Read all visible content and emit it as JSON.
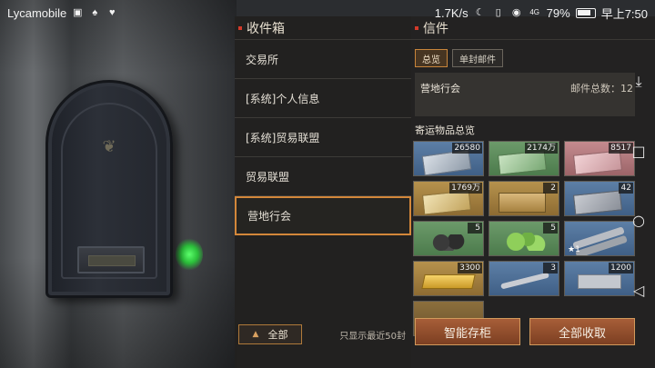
{
  "statusbar": {
    "carrier": "Lycamobile",
    "left_icons": [
      "photo-icon",
      "qq-icon",
      "health-icon"
    ],
    "speed": "1.7K/s",
    "battery": "79%",
    "time": "早上7:50",
    "signal_label": "4G"
  },
  "inbox": {
    "title": "收件箱",
    "items": [
      {
        "label": "交易所"
      },
      {
        "label": "[系统]个人信息"
      },
      {
        "label": "[系统]贸易联盟"
      },
      {
        "label": "贸易联盟"
      },
      {
        "label": "营地行会"
      }
    ],
    "filter_label": "全部",
    "footer_note": "只显示最近50封"
  },
  "letter": {
    "title": "信件",
    "tabs": [
      {
        "label": "总览",
        "active": true
      },
      {
        "label": "单封邮件",
        "active": false
      }
    ],
    "summary_name": "营地行会",
    "summary_count": "邮件总数：12",
    "section_label": "寄运物品总览",
    "items": [
      {
        "qty": "26580",
        "color": "blue",
        "art": "art-cash"
      },
      {
        "qty": "2174万",
        "color": "green",
        "art": "art-green-pack"
      },
      {
        "qty": "8517",
        "color": "pink",
        "art": "art-pink-pack"
      },
      {
        "qty": "1769万",
        "color": "gold",
        "art": "art-gold-pack"
      },
      {
        "qty": "2",
        "color": "gold",
        "art": "art-crate"
      },
      {
        "qty": "42",
        "color": "blue",
        "art": "art-tin"
      },
      {
        "qty": "5",
        "color": "green",
        "art": "art-rocks"
      },
      {
        "qty": "5",
        "color": "green",
        "art": "art-leaves"
      },
      {
        "qty": "",
        "color": "blue",
        "art": "art-bolts",
        "star": "★1"
      },
      {
        "qty": "3300",
        "color": "gold",
        "art": "art-bars"
      },
      {
        "qty": "3",
        "color": "blue",
        "art": "art-wrench"
      },
      {
        "qty": "1200",
        "color": "blue",
        "art": "art-plate"
      },
      {
        "qty": "",
        "color": "empty",
        "art": ""
      }
    ],
    "buttons": {
      "smart_storage": "智能存柜",
      "collect_all": "全部收取"
    }
  },
  "navbar": {
    "icons": [
      "download-icon",
      "square-icon",
      "circle-icon",
      "back-icon"
    ]
  },
  "colors": {
    "accent": "#d3873a",
    "button_bg": "#8d4a2a",
    "title_mark": "#d43a2a"
  }
}
